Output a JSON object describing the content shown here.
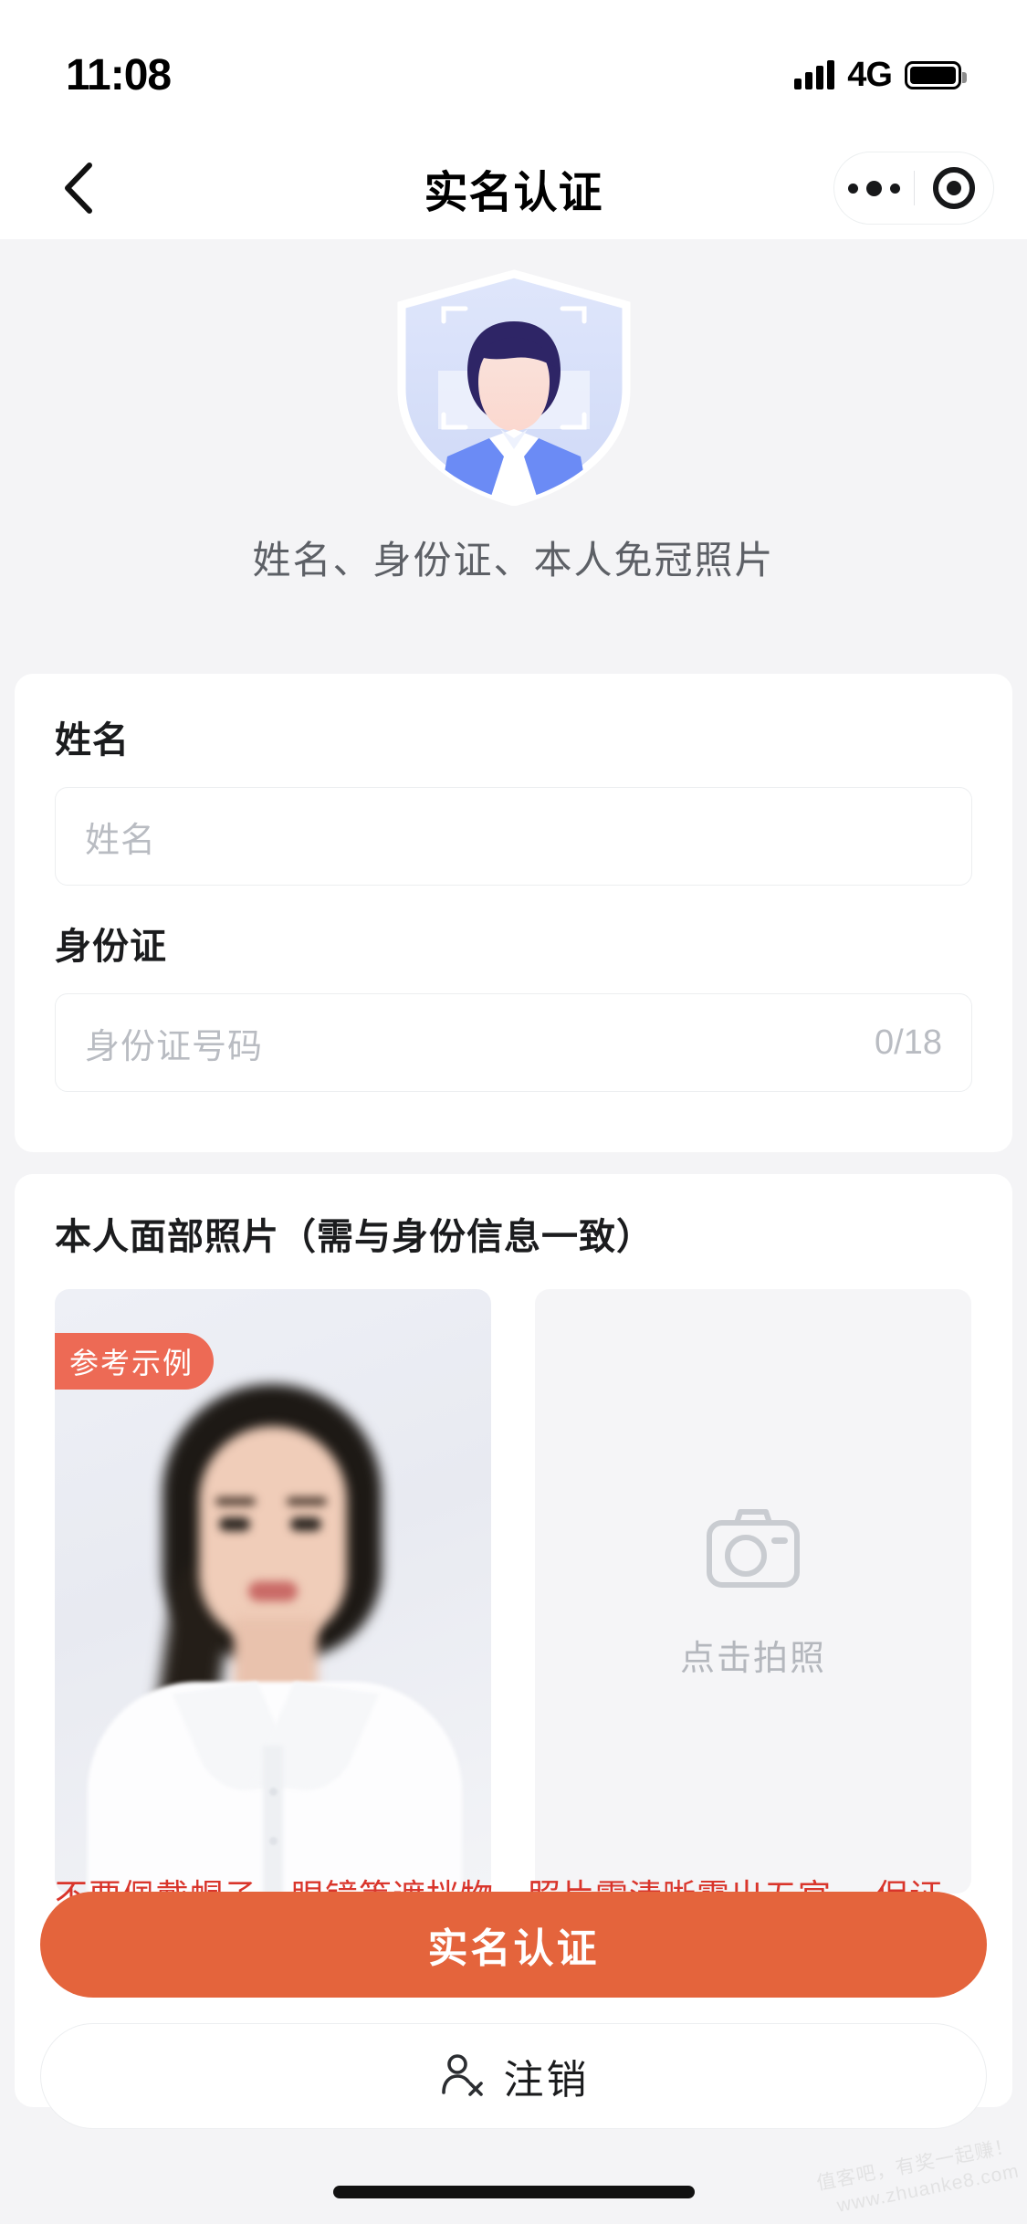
{
  "status_bar": {
    "time": "11:08",
    "network": "4G",
    "signal_icon": "signal-bars-icon",
    "battery_icon": "battery-icon"
  },
  "nav_bar": {
    "title": "实名认证",
    "back_icon": "chevron-left-icon",
    "capsule": {
      "more_icon": "more-dots-icon",
      "target_icon": "target-circle-icon"
    }
  },
  "hero": {
    "illustration_icon": "shield-person-id-icon",
    "caption": "姓名、身份证、本人免冠照片"
  },
  "form": {
    "name_field": {
      "label": "姓名",
      "placeholder": "姓名",
      "value": ""
    },
    "id_field": {
      "label": "身份证",
      "placeholder": "身份证号码",
      "value": "",
      "counter": "0/18"
    }
  },
  "photo_section": {
    "title": "本人面部照片（需与身份信息一致）",
    "reference": {
      "badge": "参考示例",
      "image_icon": "reference-portrait-image"
    },
    "capture": {
      "icon": "camera-icon",
      "label": "点击拍照"
    },
    "warning": "不要佩戴帽子、眼镜等遮挡物，照片需清晰露出五官，\n保证光线充足"
  },
  "actions": {
    "primary_label": "实名认证",
    "logout_label": "注销",
    "logout_icon": "user-remove-icon"
  },
  "watermark": {
    "line1": "值客吧，有奖一起赚！",
    "line2": "www.zhuanke8.com"
  },
  "colors": {
    "primary": "#e4643c",
    "badge": "#ed6a55",
    "warning_text": "#d9352b",
    "page_background": "#f4f4f6",
    "card_background": "#ffffff",
    "placeholder": "#b9bcc2"
  }
}
